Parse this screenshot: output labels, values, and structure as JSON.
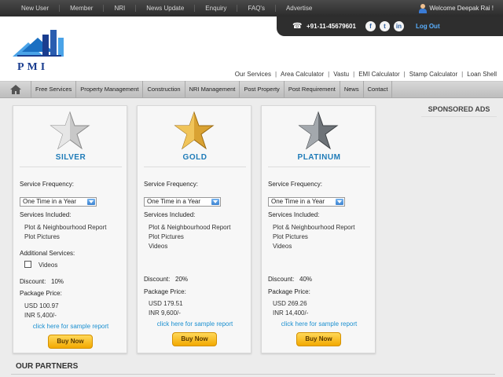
{
  "topnav": [
    "New User",
    "Member",
    "NRI",
    "News Update",
    "Enquiry",
    "FAQ's",
    "Advertise"
  ],
  "welcome": "Welcome Deepak Rai !",
  "contact": {
    "phone": "+91-11-45679601",
    "social": [
      "f",
      "t",
      "in"
    ],
    "logout": "Log Out"
  },
  "logo": {
    "text": "PMI",
    "colors": {
      "blue": "#1a3d8f",
      "light": "#4aa3e8"
    }
  },
  "links": [
    "Our Services",
    "Area Calculator",
    "Vastu",
    "EMI Calculator",
    "Stamp Calculator",
    "Loan Shell"
  ],
  "menu": [
    "Free Services",
    "Property Management",
    "Construction",
    "NRI Management",
    "Post Property",
    "Post Requirement",
    "News",
    "Contact"
  ],
  "sponsored": "SPONSORED ADS",
  "partners": "OUR PARTNERS",
  "plans": [
    {
      "name": "SILVER",
      "star_color": "#b8b8b8",
      "freq_label": "Service Frequency:",
      "freq_value": "One Time in a Year",
      "services_label": "Services Included:",
      "services": [
        "Plot & Neighbourhood Report",
        "Plot Pictures"
      ],
      "additional_label": "Additional Services:",
      "additional": "Videos",
      "discount_label": "Discount:",
      "discount": "10%",
      "price_label": "Package Price:",
      "usd": "USD 100.97",
      "inr": "INR 5,400/-",
      "sample": "click here for sample report",
      "buy": "Buy Now"
    },
    {
      "name": "GOLD",
      "star_color": "#d9a233",
      "freq_label": "Service Frequency:",
      "freq_value": "One Time in a Year",
      "services_label": "Services Included:",
      "services": [
        "Plot & Neighbourhood Report",
        "Plot Pictures",
        "Videos"
      ],
      "discount_label": "Discount:",
      "discount": "20%",
      "price_label": "Package Price:",
      "usd": "USD 179.51",
      "inr": "INR 9,600/-",
      "sample": "click here for sample report",
      "buy": "Buy Now"
    },
    {
      "name": "PLATINUM",
      "star_color": "#6e7378",
      "freq_label": "Service Frequency:",
      "freq_value": "One Time in a Year",
      "services_label": "Services Included:",
      "services": [
        "Plot & Neighbourhood Report",
        "Plot Pictures",
        "Videos"
      ],
      "discount_label": "Discount:",
      "discount": "40%",
      "price_label": "Package Price:",
      "usd": "USD 269.26",
      "inr": "INR 14,400/-",
      "sample": "click here for sample report",
      "buy": "Buy Now"
    }
  ]
}
